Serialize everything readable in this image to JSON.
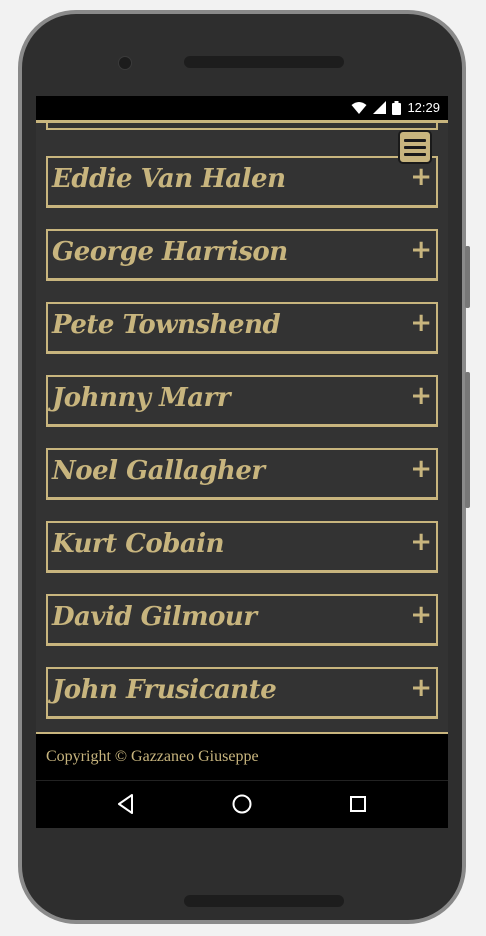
{
  "status_bar": {
    "time": "12:29",
    "icons": [
      "wifi-icon",
      "signal-icon",
      "battery-icon"
    ]
  },
  "menu": {
    "icon": "hamburger-icon"
  },
  "list": {
    "items": [
      {
        "name": "Eddie Van Halen",
        "action": "+"
      },
      {
        "name": "George Harrison",
        "action": "+"
      },
      {
        "name": "Pete Townshend",
        "action": "+"
      },
      {
        "name": "Johnny Marr",
        "action": "+"
      },
      {
        "name": "Noel Gallagher",
        "action": "+"
      },
      {
        "name": "Kurt Cobain",
        "action": "+"
      },
      {
        "name": "David Gilmour",
        "action": "+"
      },
      {
        "name": "John Frusicante",
        "action": "+"
      }
    ]
  },
  "footer": {
    "copyright": "Copyright © Gazzaneo Giuseppe"
  },
  "nav_bar": {
    "icons": [
      "back-icon",
      "home-icon",
      "recents-icon"
    ]
  },
  "colors": {
    "accent": "#c8b57e",
    "background": "#333333",
    "bar": "#000000"
  }
}
